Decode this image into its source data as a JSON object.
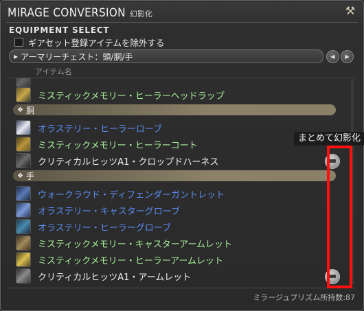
{
  "window": {
    "title": "MIRAGE CONVERSION",
    "title_jp": "幻影化",
    "section_title": "EQUIPMENT SELECT",
    "exclude_gearset_label": "ギアセット登録アイテムを除外する",
    "dropdown_value": "アーマリーチェスト：頭/胴/手",
    "column_header": "アイテム名",
    "footer_text": "ミラージュプリズム所持数:87"
  },
  "tooltip": "まとめて幻影化",
  "categories": {
    "body": "胴",
    "hands": "手"
  },
  "items": [
    {
      "name": "ミスティックメモリー・ヒーラーヘッドラップ",
      "color": "#a8ef9a",
      "icon": "headwrap-icon"
    },
    {
      "name": "オラステリー・ヒーラーローブ",
      "color": "#5a8cf0",
      "icon": "robe-icon"
    },
    {
      "name": "ミスティックメモリー・ヒーラーコート",
      "color": "#a8ef9a",
      "icon": "coat-icon"
    },
    {
      "name": "クリティカルヒッツA1・クロップドハーネス",
      "color": "#f0f0f0",
      "icon": "harness-icon"
    },
    {
      "name": "ウォークラウド・ディフェンダーガントレット",
      "color": "#5a8cf0",
      "icon": "gauntlet-icon"
    },
    {
      "name": "オラステリー・キャスターグローブ",
      "color": "#5a8cf0",
      "icon": "glove-icon"
    },
    {
      "name": "オラステリー・ヒーラーグローブ",
      "color": "#5a8cf0",
      "icon": "glove-icon"
    },
    {
      "name": "ミスティックメモリー・キャスターアームレット",
      "color": "#a8ef9a",
      "icon": "armlet-icon"
    },
    {
      "name": "ミスティックメモリー・ヒーラーアームレット",
      "color": "#a8ef9a",
      "icon": "armlet-icon"
    },
    {
      "name": "クリティカルヒッツA1・アームレット",
      "color": "#f0f0f0",
      "icon": "armlet-icon"
    }
  ]
}
